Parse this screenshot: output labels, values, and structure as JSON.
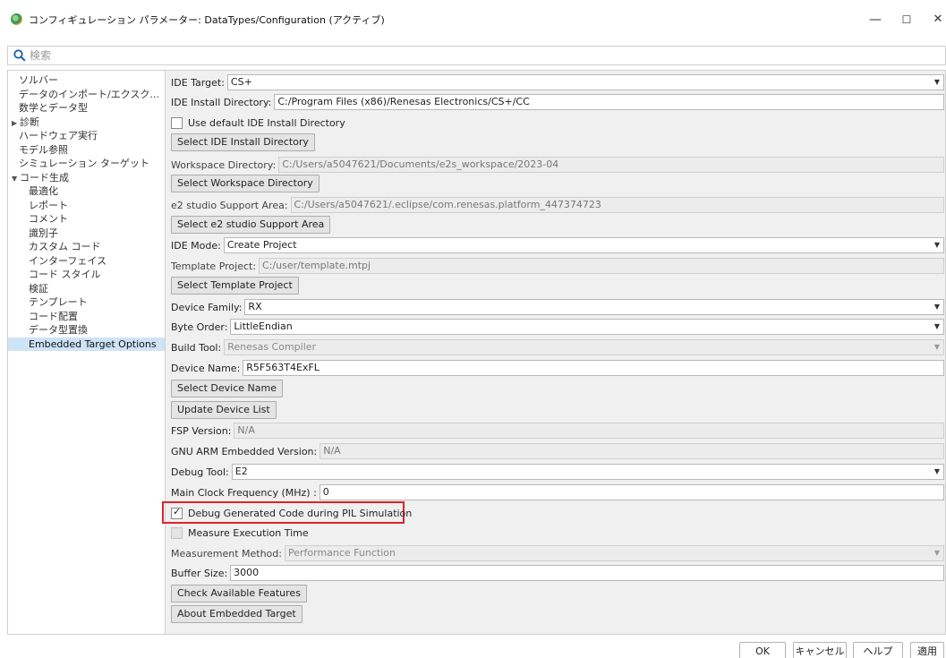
{
  "window": {
    "title": "コンフィギュレーション パラメーター: DataTypes/Configuration (アクティブ)",
    "minimize": "—",
    "maximize": "☐",
    "close": "✕"
  },
  "search": {
    "placeholder": "検索"
  },
  "tree": {
    "items": [
      {
        "label": "ソルバー"
      },
      {
        "label": "データのインポート/エクスク..."
      },
      {
        "label": "数学とデータ型"
      },
      {
        "label": "診断",
        "arrow": "▶"
      },
      {
        "label": "ハードウェア実行"
      },
      {
        "label": "モデル参照"
      },
      {
        "label": "シミュレーション ターゲット"
      },
      {
        "label": "コード生成",
        "arrow": "▼"
      },
      {
        "label": "最適化"
      },
      {
        "label": "レポート"
      },
      {
        "label": "コメント"
      },
      {
        "label": "識別子"
      },
      {
        "label": "カスタム コード"
      },
      {
        "label": "インターフェイス"
      },
      {
        "label": "コード スタイル"
      },
      {
        "label": "検証"
      },
      {
        "label": "テンプレート"
      },
      {
        "label": "コード配置"
      },
      {
        "label": "データ型置換"
      },
      {
        "label": "Embedded Target Options"
      }
    ]
  },
  "form": {
    "ide_target_label": "IDE Target:",
    "ide_target_value": "CS+",
    "ide_install_dir_label": "IDE Install Directory:",
    "ide_install_dir_value": "C:/Program Files (x86)/Renesas Electronics/CS+/CC",
    "use_default_ide_label": "Use default IDE Install Directory",
    "select_ide_dir_button": "Select IDE Install Directory",
    "workspace_dir_label": "Workspace Directory:",
    "workspace_dir_value": "C:/Users/a5047621/Documents/e2s_workspace/2023-04",
    "select_workspace_button": "Select Workspace Directory",
    "e2_support_label": "e2 studio Support Area:",
    "e2_support_value": "C:/Users/a5047621/.eclipse/com.renesas.platform_447374723",
    "select_e2_support_button": "Select e2 studio Support Area",
    "ide_mode_label": "IDE Mode:",
    "ide_mode_value": "Create Project",
    "template_project_label": "Template Project:",
    "template_project_value": "C:/user/template.mtpj",
    "select_template_button": "Select Template Project",
    "device_family_label": "Device Family:",
    "device_family_value": "RX",
    "byte_order_label": "Byte Order:",
    "byte_order_value": "LittleEndian",
    "build_tool_label": "Build Tool:",
    "build_tool_value": "Renesas Compiler",
    "device_name_label": "Device Name:",
    "device_name_value": "R5F563T4ExFL",
    "select_device_name_button": "Select Device Name",
    "update_device_list_button": "Update Device List",
    "fsp_version_label": "FSP Version:",
    "fsp_version_value": "N/A",
    "gnu_arm_label": "GNU ARM Embedded Version:",
    "gnu_arm_value": "N/A",
    "debug_tool_label": "Debug Tool:",
    "debug_tool_value": "E2",
    "main_clock_label": "Main Clock Frequency (MHz) :",
    "main_clock_value": "0",
    "debug_generated_label": "Debug Generated Code during PIL Simulation",
    "measure_exec_label": "Measure Execution Time",
    "measurement_method_label": "Measurement Method:",
    "measurement_method_value": "Performance Function",
    "buffer_size_label": "Buffer Size:",
    "buffer_size_value": "3000",
    "check_features_button": "Check Available Features",
    "about_target_button": "About Embedded Target"
  },
  "footer": {
    "ok": "OK",
    "cancel": "キャンセル",
    "help": "ヘルプ",
    "apply": "適用"
  },
  "colors": {
    "highlight": "#e0222a",
    "selected_tree": "#cfe3f7"
  }
}
